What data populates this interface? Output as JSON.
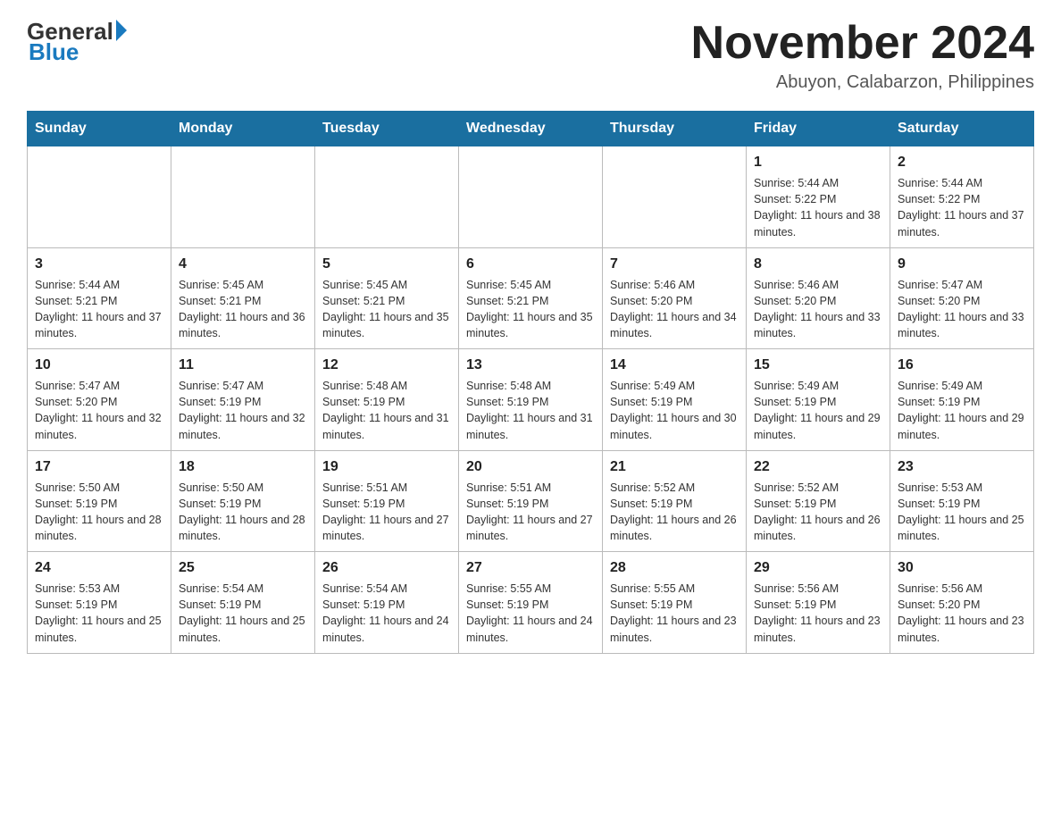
{
  "header": {
    "logo_general": "General",
    "logo_blue": "Blue",
    "month_title": "November 2024",
    "location": "Abuyon, Calabarzon, Philippines"
  },
  "days_of_week": [
    "Sunday",
    "Monday",
    "Tuesday",
    "Wednesday",
    "Thursday",
    "Friday",
    "Saturday"
  ],
  "weeks": [
    [
      {
        "day": "",
        "info": ""
      },
      {
        "day": "",
        "info": ""
      },
      {
        "day": "",
        "info": ""
      },
      {
        "day": "",
        "info": ""
      },
      {
        "day": "",
        "info": ""
      },
      {
        "day": "1",
        "info": "Sunrise: 5:44 AM\nSunset: 5:22 PM\nDaylight: 11 hours and 38 minutes."
      },
      {
        "day": "2",
        "info": "Sunrise: 5:44 AM\nSunset: 5:22 PM\nDaylight: 11 hours and 37 minutes."
      }
    ],
    [
      {
        "day": "3",
        "info": "Sunrise: 5:44 AM\nSunset: 5:21 PM\nDaylight: 11 hours and 37 minutes."
      },
      {
        "day": "4",
        "info": "Sunrise: 5:45 AM\nSunset: 5:21 PM\nDaylight: 11 hours and 36 minutes."
      },
      {
        "day": "5",
        "info": "Sunrise: 5:45 AM\nSunset: 5:21 PM\nDaylight: 11 hours and 35 minutes."
      },
      {
        "day": "6",
        "info": "Sunrise: 5:45 AM\nSunset: 5:21 PM\nDaylight: 11 hours and 35 minutes."
      },
      {
        "day": "7",
        "info": "Sunrise: 5:46 AM\nSunset: 5:20 PM\nDaylight: 11 hours and 34 minutes."
      },
      {
        "day": "8",
        "info": "Sunrise: 5:46 AM\nSunset: 5:20 PM\nDaylight: 11 hours and 33 minutes."
      },
      {
        "day": "9",
        "info": "Sunrise: 5:47 AM\nSunset: 5:20 PM\nDaylight: 11 hours and 33 minutes."
      }
    ],
    [
      {
        "day": "10",
        "info": "Sunrise: 5:47 AM\nSunset: 5:20 PM\nDaylight: 11 hours and 32 minutes."
      },
      {
        "day": "11",
        "info": "Sunrise: 5:47 AM\nSunset: 5:19 PM\nDaylight: 11 hours and 32 minutes."
      },
      {
        "day": "12",
        "info": "Sunrise: 5:48 AM\nSunset: 5:19 PM\nDaylight: 11 hours and 31 minutes."
      },
      {
        "day": "13",
        "info": "Sunrise: 5:48 AM\nSunset: 5:19 PM\nDaylight: 11 hours and 31 minutes."
      },
      {
        "day": "14",
        "info": "Sunrise: 5:49 AM\nSunset: 5:19 PM\nDaylight: 11 hours and 30 minutes."
      },
      {
        "day": "15",
        "info": "Sunrise: 5:49 AM\nSunset: 5:19 PM\nDaylight: 11 hours and 29 minutes."
      },
      {
        "day": "16",
        "info": "Sunrise: 5:49 AM\nSunset: 5:19 PM\nDaylight: 11 hours and 29 minutes."
      }
    ],
    [
      {
        "day": "17",
        "info": "Sunrise: 5:50 AM\nSunset: 5:19 PM\nDaylight: 11 hours and 28 minutes."
      },
      {
        "day": "18",
        "info": "Sunrise: 5:50 AM\nSunset: 5:19 PM\nDaylight: 11 hours and 28 minutes."
      },
      {
        "day": "19",
        "info": "Sunrise: 5:51 AM\nSunset: 5:19 PM\nDaylight: 11 hours and 27 minutes."
      },
      {
        "day": "20",
        "info": "Sunrise: 5:51 AM\nSunset: 5:19 PM\nDaylight: 11 hours and 27 minutes."
      },
      {
        "day": "21",
        "info": "Sunrise: 5:52 AM\nSunset: 5:19 PM\nDaylight: 11 hours and 26 minutes."
      },
      {
        "day": "22",
        "info": "Sunrise: 5:52 AM\nSunset: 5:19 PM\nDaylight: 11 hours and 26 minutes."
      },
      {
        "day": "23",
        "info": "Sunrise: 5:53 AM\nSunset: 5:19 PM\nDaylight: 11 hours and 25 minutes."
      }
    ],
    [
      {
        "day": "24",
        "info": "Sunrise: 5:53 AM\nSunset: 5:19 PM\nDaylight: 11 hours and 25 minutes."
      },
      {
        "day": "25",
        "info": "Sunrise: 5:54 AM\nSunset: 5:19 PM\nDaylight: 11 hours and 25 minutes."
      },
      {
        "day": "26",
        "info": "Sunrise: 5:54 AM\nSunset: 5:19 PM\nDaylight: 11 hours and 24 minutes."
      },
      {
        "day": "27",
        "info": "Sunrise: 5:55 AM\nSunset: 5:19 PM\nDaylight: 11 hours and 24 minutes."
      },
      {
        "day": "28",
        "info": "Sunrise: 5:55 AM\nSunset: 5:19 PM\nDaylight: 11 hours and 23 minutes."
      },
      {
        "day": "29",
        "info": "Sunrise: 5:56 AM\nSunset: 5:19 PM\nDaylight: 11 hours and 23 minutes."
      },
      {
        "day": "30",
        "info": "Sunrise: 5:56 AM\nSunset: 5:20 PM\nDaylight: 11 hours and 23 minutes."
      }
    ]
  ]
}
